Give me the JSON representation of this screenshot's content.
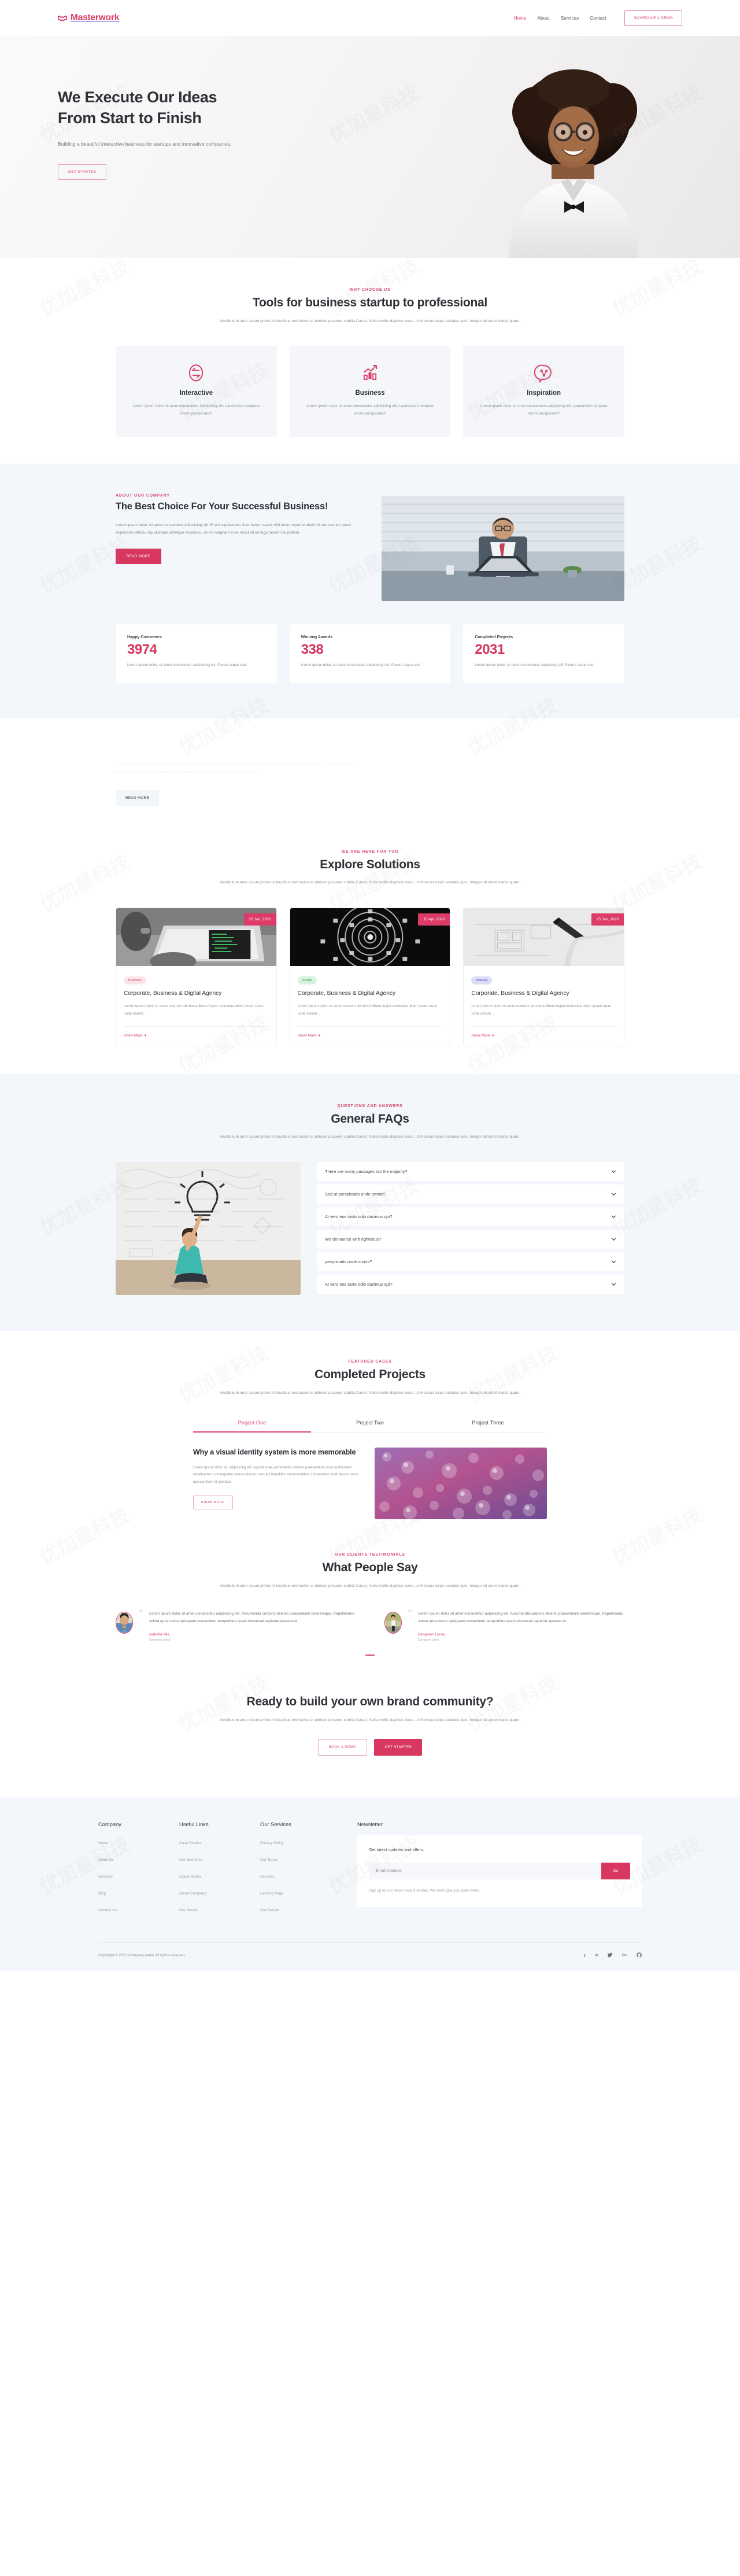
{
  "brand": {
    "name": "Masterwork",
    "accent": "#d8375f",
    "logo_icon": "handshake-icon"
  },
  "header": {
    "nav": [
      {
        "label": "Home",
        "active": true
      },
      {
        "label": "About",
        "active": false
      },
      {
        "label": "Services",
        "active": false
      },
      {
        "label": "Contact",
        "active": false
      }
    ],
    "cta_label": "SCHEDULE A DEMO"
  },
  "hero": {
    "title_line1": "We Execute Our Ideas",
    "title_line2": "From Start to Finish",
    "subtitle": "Building a beautiful interactive business for startups and innovative companies.",
    "cta_label": "GET STARTED"
  },
  "why": {
    "eyebrow": "WHY CHOOSE US",
    "title": "Tools for business startup to professional",
    "subtitle": "Vestibulum ante ipsum primis in faucibus orci luctus et ultrices posuere cubilia Curae; Nulla mollis dapibus nunc, ut rhoncus turpis sodales quis. Integer sit amet mattis quam.",
    "cards": [
      {
        "icon": "exchange-arrows-icon",
        "title": "Interactive",
        "text": "Lorem ipsum dolor sit amet consectetur adipisicing elit. Laudantium tempora rerum perspiciatis?"
      },
      {
        "icon": "growth-chart-icon",
        "title": "Business",
        "text": "Lorem ipsum dolor sit amet consectetur adipisicing elit. Laudantium tempora rerum perspiciatis?"
      },
      {
        "icon": "idea-bubble-icon",
        "title": "Inspiration",
        "text": "Lorem ipsum dolor sit amet consectetur adipisicing elit. Laudantium tempora rerum perspiciatis?"
      }
    ]
  },
  "about": {
    "eyebrow": "ABOUT OUR COMPANY",
    "title": "The Best Choice For Your Successful Business!",
    "text": "Lorem ipsum dolor, sit amet consectetur adipisicing elit. Et est repellendus illum harum quam nihil totam reprehenderit! Ut sed eveniet quos! Asperiores officia, repudiandae similique reiciendis, ab est magnam esse nesciunt ea fuga facere voluptatem.",
    "cta_label": "READ MORE",
    "image_alt": "businessman-at-laptop-photo",
    "stats": [
      {
        "label": "Happy Customers",
        "value": "3974",
        "text": "Lorem ipsum dolor, sit amet consectetur adipisicing elit. Facere atque sed."
      },
      {
        "label": "Winning Awards",
        "value": "338",
        "text": "Lorem ipsum dolor, sit amet consectetur adipisicing elit. Facere atque sed."
      },
      {
        "label": "Completed Projects",
        "value": "2031",
        "text": "Lorem ipsum dolor, sit amet consectetur adipisicing elit. Facere atque sed."
      }
    ]
  },
  "faded_section": {
    "title": "",
    "text": "Lorem ipsum dolor sit amet consectetur adipisicing elit. Nam dolores dolorem dolor quis consectetur voluptatem quisquam, consequatur minus voluptas beatae! Maxime dolore sed voluptate sit consequatur placeat fugit dolores.",
    "cta_label": "READ MORE"
  },
  "solutions": {
    "eyebrow": "WE ARE HERE FOR YOU",
    "title": "Explore Solutions",
    "subtitle": "Vestibulum ante ipsum primis in faucibus orci luctus et ultrices posuere cubilia Curae; Nulla mollis dapibus nunc, ut rhoncus turpis sodales quis. Integer sit amet mattis quam.",
    "posts": [
      {
        "date": "26 Jan, 2020",
        "tag": "Business",
        "tag_style": "business",
        "title": "Corporate, Business & Digital Agency",
        "excerpt": "Lorem ipsum dolor sit amet nostrum ad minus libero fugiat molestiae ullam ipsam quas unde earum...",
        "link_label": "Know More ➜",
        "image_alt": "laptop-code-photo"
      },
      {
        "date": "15 Apr, 2020",
        "tag": "Design",
        "tag_style": "design",
        "title": "Corporate, Business & Digital Agency",
        "excerpt": "Lorem ipsum dolor sit amet nostrum ad minus libero fugiat molestiae ullam ipsam quas unde earum...",
        "link_label": "Know More ➜",
        "image_alt": "dark-spiral-photo"
      },
      {
        "date": "25 Jun, 2020",
        "tag": "Industry",
        "tag_style": "industry",
        "title": "Corporate, Business & Digital Agency",
        "excerpt": "Lorem ipsum dolor sit amet nostrum ad minus libero fugiat molestiae ullam ipsam quas unde earum...",
        "link_label": "Know More ➜",
        "image_alt": "blueprint-drawing-photo"
      }
    ]
  },
  "faq": {
    "eyebrow": "QUESTIONS AND ANSWERS",
    "title": "General FAQs",
    "subtitle": "Vestibulum ante ipsum primis in faucibus orci luctus et ultrices posuere cubilia Curae; Nulla mollis dapibus nunc, ut rhoncus turpis sodales quis. Integer sit amet mattis quam.",
    "image_alt": "woman-with-lightbulb-drawing-photo",
    "items": [
      "There are many passages but the majority?",
      "Sed ut perspiciatis unde omnis?",
      "At vero eos iusto odio ducimus qui?",
      "We denounce with righteous?",
      "perspiciatis unde omnis?",
      "At vero eos iusto odio ducimus qui?"
    ]
  },
  "projects": {
    "eyebrow": "FEATURED CASES",
    "title": "Completed Projects",
    "subtitle": "Vestibulum ante ipsum primis in faucibus orci luctus et ultrices posuere cubilia Curae; Nulla mollis dapibus nunc, ut rhoncus turpis sodales quis. Integer sit amet mattis quam.",
    "tabs": [
      {
        "label": "Project One",
        "active": true
      },
      {
        "label": "Project Two",
        "active": false
      },
      {
        "label": "Project Three",
        "active": false
      }
    ],
    "panel": {
      "title": "Why a visual identity system is more memorable",
      "text": "Lorem ipsum dolor sit, adipisicing elit repudiandae perferendis dolores praesentium nulla quibusdam repellendus. consequatur minus aliquam corrupti blanditiis, necessitatibus consectetur modi ipsum natus accusantium sit pariatur.",
      "cta_label": "KNOW MORE",
      "image_alt": "purple-water-droplets-photo"
    }
  },
  "testimonials": {
    "eyebrow": "OUR CLIENTS TESTIMONIALS",
    "title": "What People Say",
    "subtitle": "Vestibulum ante ipsum primis in faucibus orci luctus et ultrices posuere cubilia Curae; Nulla mollis dapibus nunc, ut rhoncus turpis sodales quis. Integer sit amet mattis quam.",
    "items": [
      {
        "quote": "Lorem ipsum dolor sit amet consectetur adipisicing elit. Assumenda corporis deleniti praesentium doloremque. Repellendus soluta quos nemo quisquam consectetur temporibus quam obcaecati sapiente quaerat et.",
        "name": "Isabella Mia",
        "role": "Company name",
        "avatar_alt": "client-portrait-1"
      },
      {
        "quote": "Lorem ipsum dolor sit amet consectetur adipisicing elit. Assumenda corporis deleniti praesentium doloremque. Repellendus soluta quos nemo quisquam consectetur temporibus quam obcaecati sapiente quaerat et.",
        "name": "Benjamin Lucas",
        "role": "Company name",
        "avatar_alt": "client-portrait-2"
      }
    ]
  },
  "cta": {
    "title": "Ready to build your own brand community?",
    "subtitle": "Vestibulum ante ipsum primis in faucibus orci luctus et ultrices posuere cubilia Curae; Nulla mollis dapibus nunc, ut rhoncus turpis sodales quis. Integer sit amet mattis quam.",
    "btn_outline": "BOOK A DEMO",
    "btn_solid": "GET STARTED"
  },
  "footer": {
    "columns": [
      {
        "title": "Company",
        "links": [
          "Home",
          "About Us",
          "Services",
          "Blog",
          "Contact Us"
        ]
      },
      {
        "title": "Useful Links",
        "links": [
          "Case Studies",
          "Our Branches",
          "Latest Media",
          "About Company",
          "Our People"
        ]
      },
      {
        "title": "Our Services",
        "links": [
          "Privacy Policy",
          "Our Terms",
          "Services",
          "Landing Page",
          "Our People"
        ]
      }
    ],
    "newsletter": {
      "title": "Newsletter",
      "lead": "Get latest updates and offers.",
      "placeholder": "Email Address",
      "button": "Go",
      "note": "Sign up for our latest news & articles. We won't give you spam mails."
    },
    "copyright": "Copyright © 2021.Company name All rights reserved.",
    "socials": [
      {
        "name": "facebook-icon",
        "glyph": "f"
      },
      {
        "name": "linkedin-icon",
        "glyph": "in"
      },
      {
        "name": "twitter-icon",
        "glyph": "🐦"
      },
      {
        "name": "google-plus-icon",
        "glyph": "G+"
      },
      {
        "name": "github-icon",
        "glyph": "⚲"
      }
    ]
  }
}
